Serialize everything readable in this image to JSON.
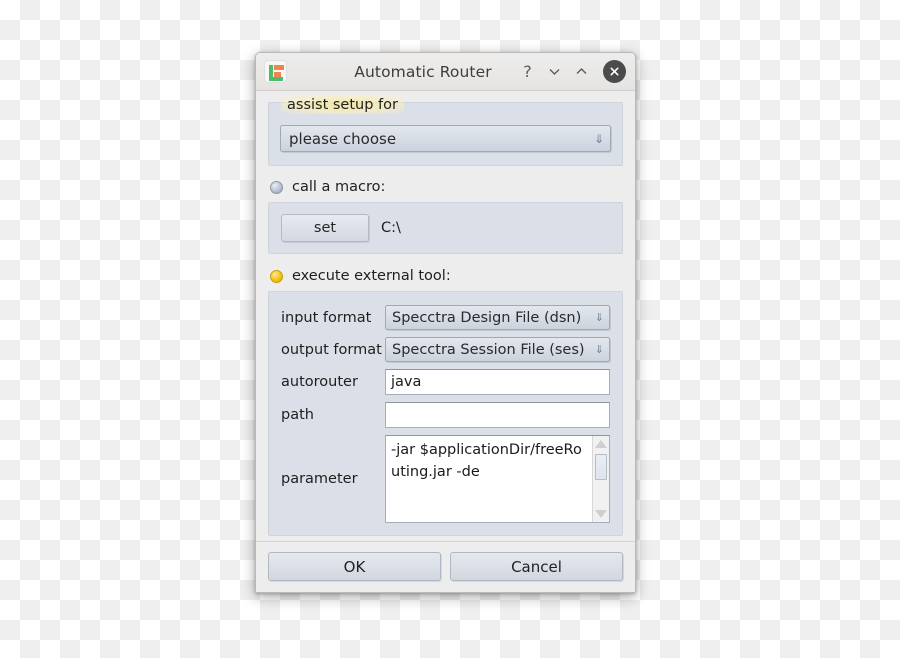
{
  "window": {
    "title": "Automatic Router",
    "icon_name": "app-logo-icon",
    "controls": {
      "help_label": "?",
      "minimize_name": "chevron-down-icon",
      "maximize_name": "chevron-up-icon",
      "close_name": "close-icon"
    }
  },
  "assist": {
    "label": "assist setup for",
    "combo_value": "please choose",
    "combo_arrow": "⇓"
  },
  "macro": {
    "radio_label": "call a macro:",
    "radio_selected": false,
    "set_button": "set",
    "path_value": "C:\\"
  },
  "tool": {
    "radio_label": "execute external tool:",
    "radio_selected": true,
    "fields": [
      {
        "label": "input format",
        "type": "combo",
        "value": "Specctra Design File (dsn)",
        "arrow": "⇓"
      },
      {
        "label": "output format",
        "type": "combo",
        "value": "Specctra Session File (ses)",
        "arrow": "⇓"
      },
      {
        "label": "autorouter",
        "type": "text",
        "value": "java"
      },
      {
        "label": "path",
        "type": "text",
        "value": ""
      },
      {
        "label": "parameter",
        "type": "textarea",
        "value": "-jar $applicationDir/freeRouting.jar -de"
      }
    ]
  },
  "footer": {
    "ok_label": "OK",
    "cancel_label": "Cancel"
  },
  "colors": {
    "panel_bg": "#dbdfe7",
    "dialog_bg": "#ededed",
    "titlebar_bg": "#e9e8e6",
    "radio_selected": "#f2c41c",
    "radio_unselected": "#b9c3d4",
    "close_circle": "#4b4b4b",
    "highlight_glow": "#f5e6a0"
  }
}
